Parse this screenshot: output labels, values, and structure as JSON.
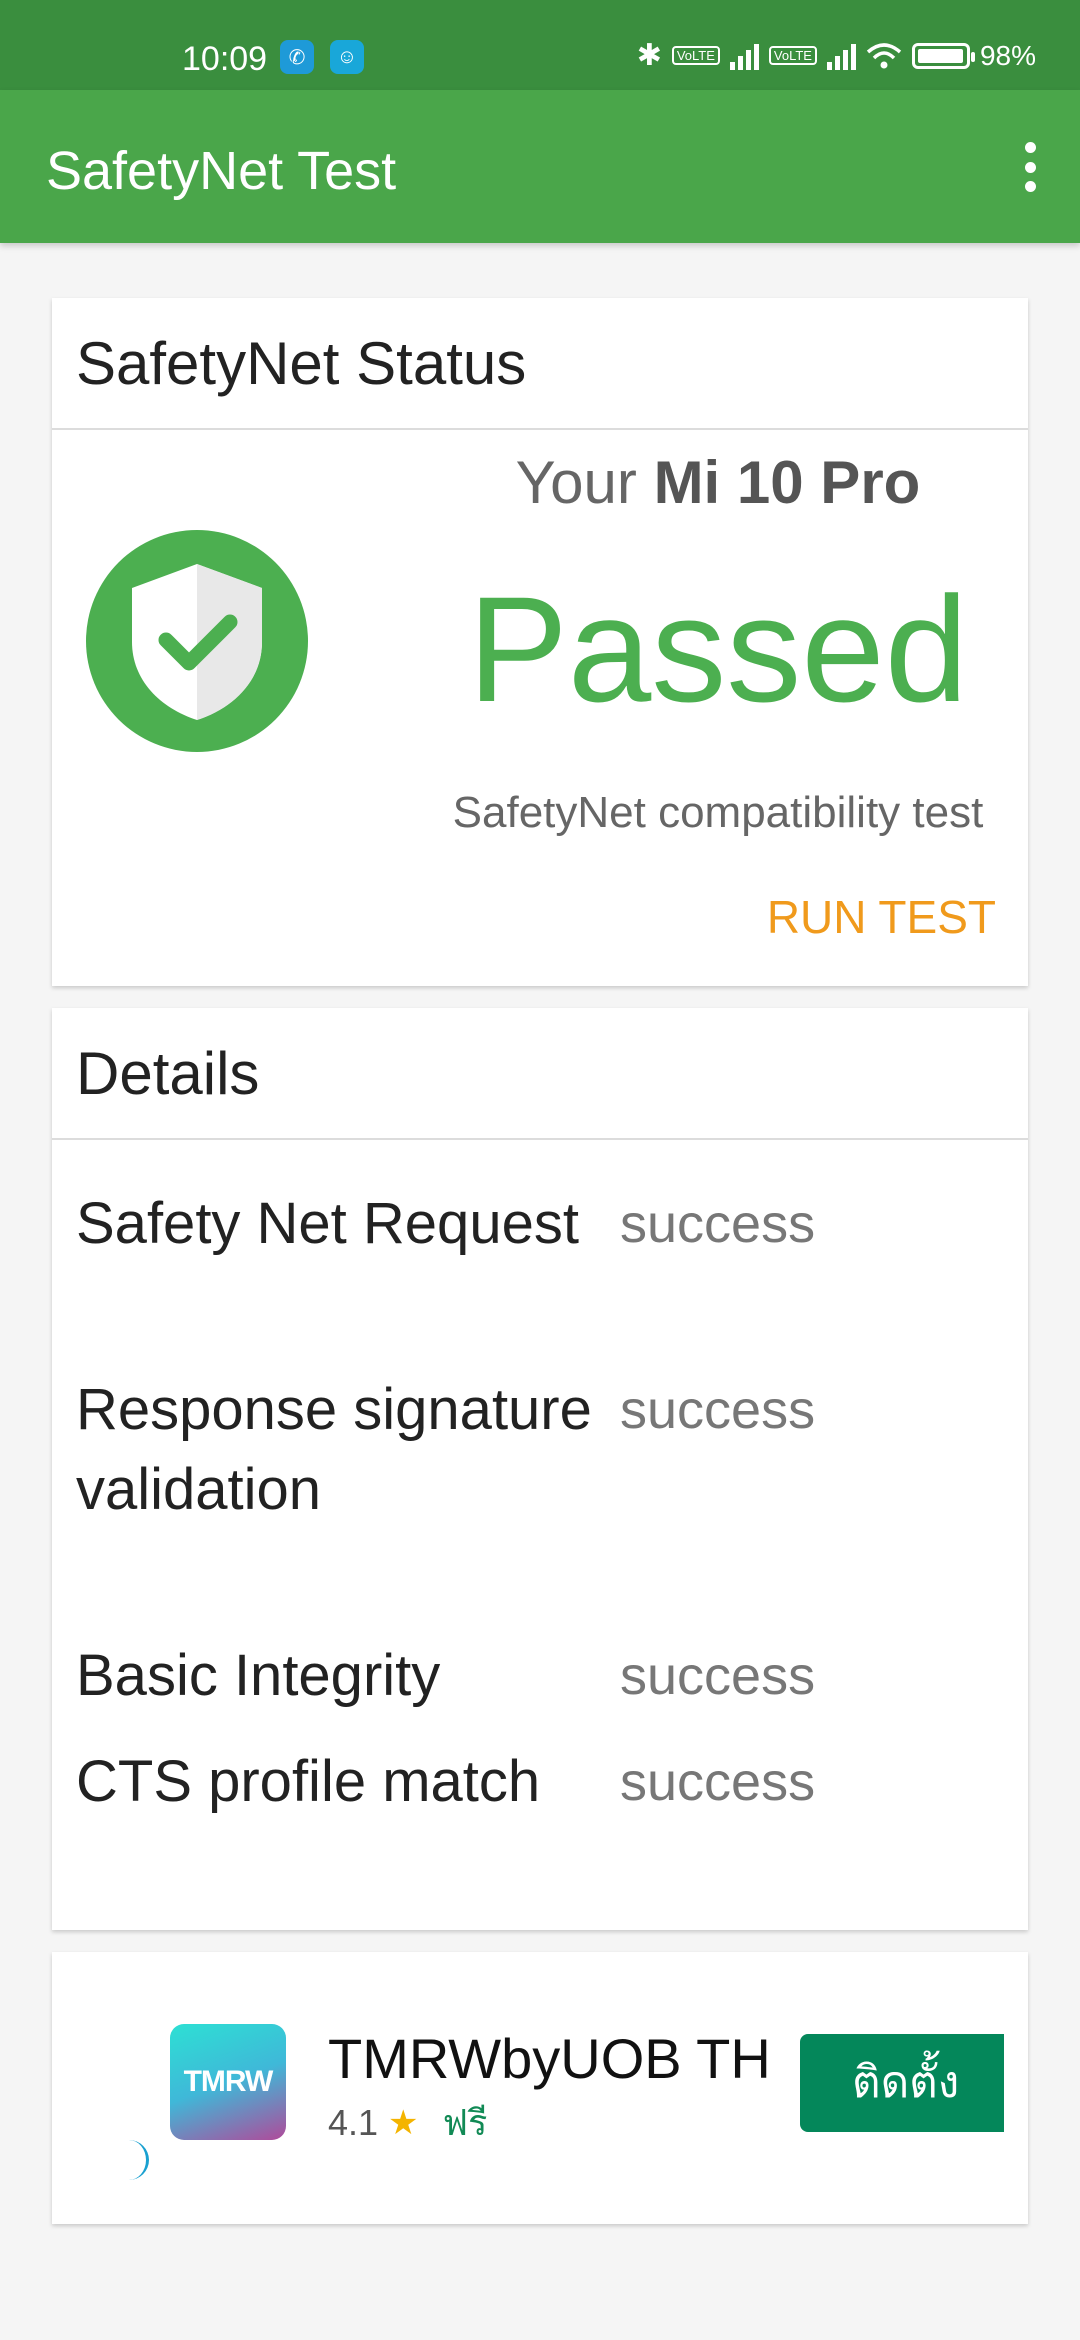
{
  "status_bar": {
    "time": "10:09",
    "volte_1": "Vo\nLTE",
    "volte_2": "Vo\nLTE",
    "battery_percent_text": "98%",
    "battery_level": 0.98,
    "icons": [
      "phone-app-icon",
      "notification-app-icon",
      "bluetooth-icon",
      "volte-icon",
      "signal-icon",
      "volte-icon",
      "signal-icon",
      "wifi-icon",
      "battery-icon"
    ]
  },
  "app_bar": {
    "title": "SafetyNet Test",
    "menu_icon": "more-vert-icon"
  },
  "status_card": {
    "header": "SafetyNet Status",
    "your_prefix": "Your ",
    "device": "Mi 10 Pro",
    "result": "Passed",
    "subtitle": "SafetyNet compatibility test",
    "run_test": "RUN TEST",
    "icon": "shield-check-icon"
  },
  "details_card": {
    "header": "Details",
    "rows": [
      {
        "label": "Safety Net Request",
        "value": "success"
      },
      {
        "label": "Response signature validation",
        "value": "success"
      },
      {
        "label": "Basic Integrity",
        "value": "success"
      },
      {
        "label": "CTS profile match",
        "value": "success"
      }
    ]
  },
  "ad": {
    "icon_text": "TMRW",
    "title": "TMRWbyUOB TH",
    "rating": "4.1",
    "price": "ฟรี",
    "install_label": "ติดตั้ง"
  },
  "colors": {
    "status_bar": "#3a8e3e",
    "app_bar": "#4aa64a",
    "passed": "#4caf50",
    "run_test": "#f09a1c",
    "install_button": "#04875a"
  }
}
